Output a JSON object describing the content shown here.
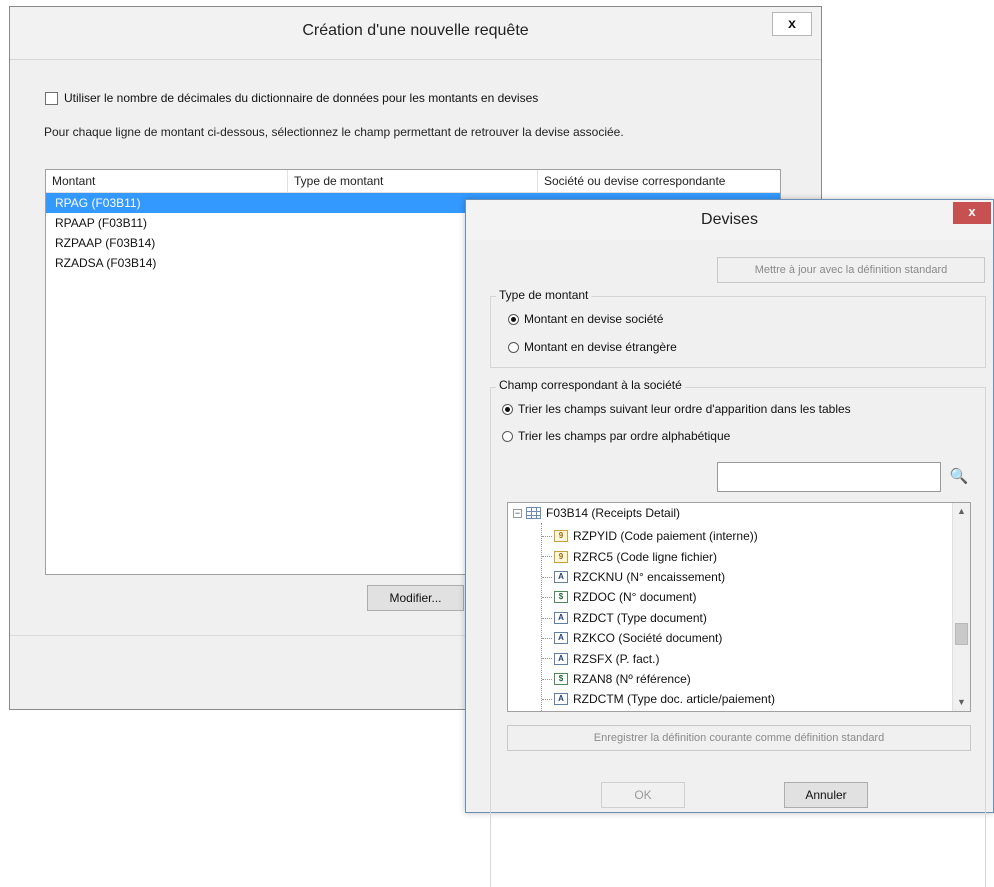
{
  "main_window": {
    "title": "Création d'une nouvelle requête",
    "close_label": "x",
    "checkbox_label": "Utiliser le nombre de décimales du dictionnaire de données pour les montants en devises",
    "instruction": "Pour chaque ligne de montant ci-dessous, sélectionnez le champ permettant de retrouver la devise associée.",
    "columns": [
      "Montant",
      "Type de montant",
      "Société ou devise correspondante"
    ],
    "rows": [
      "RPAG (F03B11)",
      "RPAAP (F03B11)",
      "RZPAAP (F03B14)",
      "RZADSA (F03B14)"
    ],
    "selected_row": 0,
    "modify_button": "Modifier..."
  },
  "devises_dialog": {
    "title": "Devises",
    "close_label": "x",
    "update_button": "Mettre à jour avec la définition standard",
    "amount_type_group": {
      "title": "Type de montant",
      "options": [
        "Montant en devise société",
        "Montant en devise étrangère"
      ],
      "selected": 0
    },
    "company_field_group": {
      "title": "Champ correspondant à la société",
      "sort_options": [
        "Trier les champs suivant leur ordre d'apparition dans les tables",
        "Trier les champs par ordre alphabétique"
      ],
      "selected": 0,
      "search_value": ""
    },
    "tree": {
      "root": "F03B14 (Receipts Detail)",
      "items": [
        {
          "label": "RZPYID (Code paiement (interne))",
          "icon": "numeric-field-icon"
        },
        {
          "label": "RZRC5 (Code ligne fichier)",
          "icon": "numeric-field-icon"
        },
        {
          "label": "RZCKNU (N° encaissement)",
          "icon": "alpha-field-icon"
        },
        {
          "label": "RZDOC (N° document)",
          "icon": "decimal-field-icon"
        },
        {
          "label": "RZDCT (Type document)",
          "icon": "alpha-field-icon"
        },
        {
          "label": "RZKCO (Société document)",
          "icon": "alpha-field-icon"
        },
        {
          "label": "RZSFX (P. fact.)",
          "icon": "alpha-field-icon"
        },
        {
          "label": "RZAN8 (Nº référence)",
          "icon": "decimal-field-icon"
        },
        {
          "label": "RZDCTM (Type doc. article/paiement)",
          "icon": "alpha-field-icon"
        }
      ]
    },
    "save_button": "Enregistrer la définition courante comme définition standard",
    "ok_button": "OK",
    "cancel_button": "Annuler"
  },
  "colors": {
    "selection": "#3399ff",
    "close_red": "#c75050",
    "window_bg": "#f0f0f0"
  }
}
